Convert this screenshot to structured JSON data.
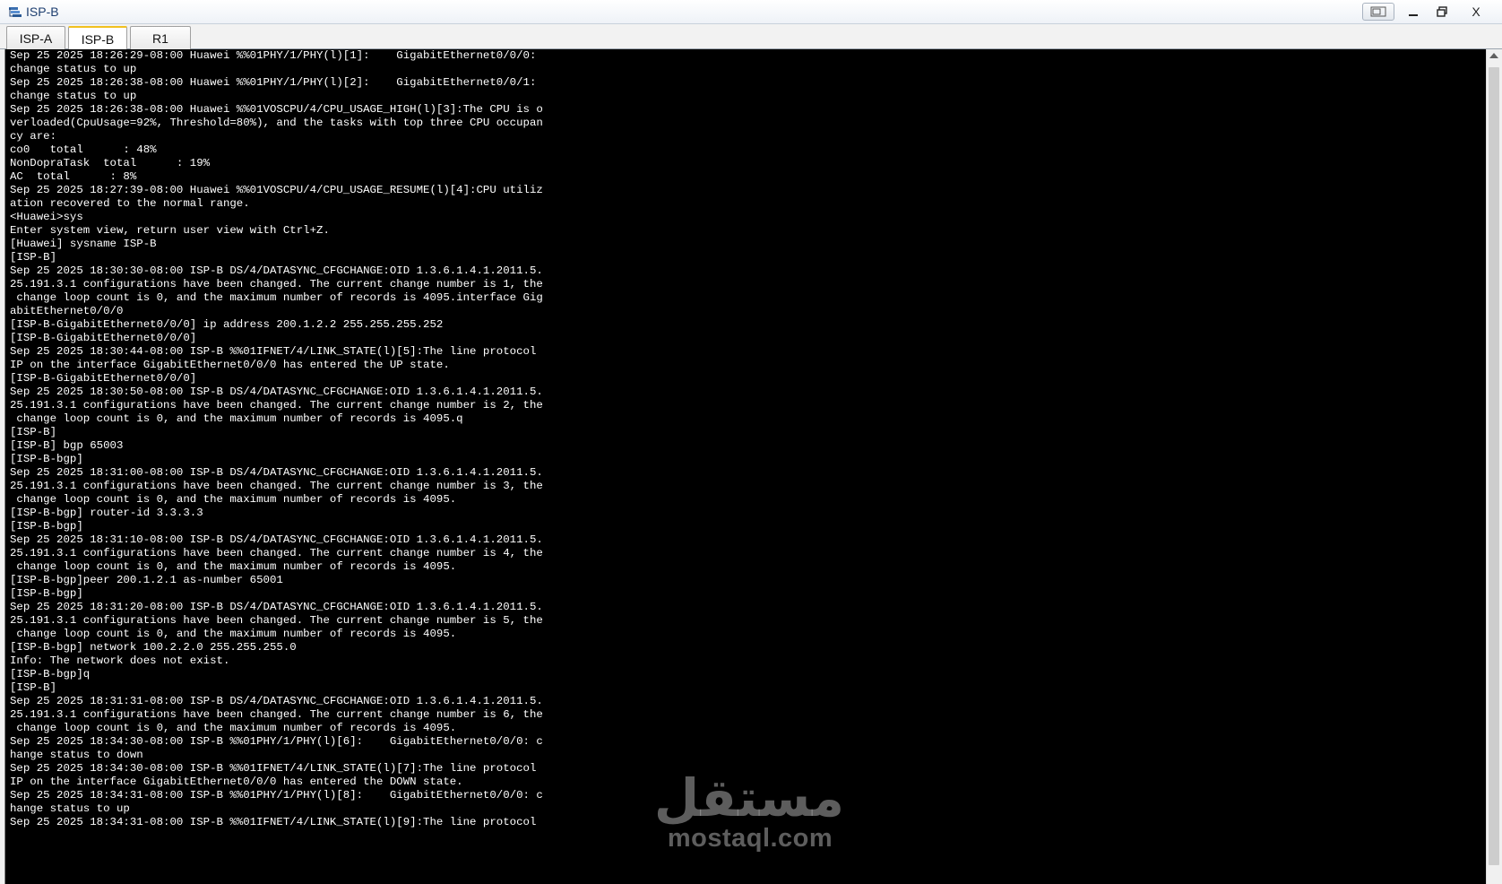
{
  "window": {
    "title": "ISP-B",
    "controls": {
      "extra": "▭",
      "minimize": "–",
      "maximize": "🗗",
      "close": "X"
    }
  },
  "tabs": [
    {
      "label": "ISP-A",
      "active": false
    },
    {
      "label": "ISP-B",
      "active": true
    },
    {
      "label": "R1",
      "active": false
    }
  ],
  "terminal": {
    "lines": [
      "Sep 25 2025 18:26:29-08:00 Huawei %%01PHY/1/PHY(l)[1]:    GigabitEthernet0/0/0:",
      "change status to up",
      "Sep 25 2025 18:26:38-08:00 Huawei %%01PHY/1/PHY(l)[2]:    GigabitEthernet0/0/1:",
      "change status to up",
      "Sep 25 2025 18:26:38-08:00 Huawei %%01VOSCPU/4/CPU_USAGE_HIGH(l)[3]:The CPU is o",
      "verloaded(CpuUsage=92%, Threshold=80%), and the tasks with top three CPU occupan",
      "cy are:",
      "co0   total      : 48%",
      "NonDopraTask  total      : 19%",
      "AC  total      : 8%",
      "Sep 25 2025 18:27:39-08:00 Huawei %%01VOSCPU/4/CPU_USAGE_RESUME(l)[4]:CPU utiliz",
      "ation recovered to the normal range.",
      "<Huawei>sys",
      "Enter system view, return user view with Ctrl+Z.",
      "[Huawei] sysname ISP-B",
      "[ISP-B]",
      "Sep 25 2025 18:30:30-08:00 ISP-B DS/4/DATASYNC_CFGCHANGE:OID 1.3.6.1.4.1.2011.5.",
      "25.191.3.1 configurations have been changed. The current change number is 1, the",
      " change loop count is 0, and the maximum number of records is 4095.interface Gig",
      "abitEthernet0/0/0",
      "[ISP-B-GigabitEthernet0/0/0] ip address 200.1.2.2 255.255.255.252",
      "[ISP-B-GigabitEthernet0/0/0]",
      "Sep 25 2025 18:30:44-08:00 ISP-B %%01IFNET/4/LINK_STATE(l)[5]:The line protocol",
      "IP on the interface GigabitEthernet0/0/0 has entered the UP state.",
      "[ISP-B-GigabitEthernet0/0/0]",
      "Sep 25 2025 18:30:50-08:00 ISP-B DS/4/DATASYNC_CFGCHANGE:OID 1.3.6.1.4.1.2011.5.",
      "25.191.3.1 configurations have been changed. The current change number is 2, the",
      " change loop count is 0, and the maximum number of records is 4095.q",
      "[ISP-B]",
      "[ISP-B] bgp 65003",
      "[ISP-B-bgp]",
      "Sep 25 2025 18:31:00-08:00 ISP-B DS/4/DATASYNC_CFGCHANGE:OID 1.3.6.1.4.1.2011.5.",
      "25.191.3.1 configurations have been changed. The current change number is 3, the",
      " change loop count is 0, and the maximum number of records is 4095.",
      "[ISP-B-bgp] router-id 3.3.3.3",
      "[ISP-B-bgp]",
      "Sep 25 2025 18:31:10-08:00 ISP-B DS/4/DATASYNC_CFGCHANGE:OID 1.3.6.1.4.1.2011.5.",
      "25.191.3.1 configurations have been changed. The current change number is 4, the",
      " change loop count is 0, and the maximum number of records is 4095.",
      "[ISP-B-bgp]peer 200.1.2.1 as-number 65001",
      "[ISP-B-bgp]",
      "Sep 25 2025 18:31:20-08:00 ISP-B DS/4/DATASYNC_CFGCHANGE:OID 1.3.6.1.4.1.2011.5.",
      "25.191.3.1 configurations have been changed. The current change number is 5, the",
      " change loop count is 0, and the maximum number of records is 4095.",
      "[ISP-B-bgp] network 100.2.2.0 255.255.255.0",
      "Info: The network does not exist.",
      "[ISP-B-bgp]q",
      "[ISP-B]",
      "Sep 25 2025 18:31:31-08:00 ISP-B DS/4/DATASYNC_CFGCHANGE:OID 1.3.6.1.4.1.2011.5.",
      "25.191.3.1 configurations have been changed. The current change number is 6, the",
      " change loop count is 0, and the maximum number of records is 4095.",
      "Sep 25 2025 18:34:30-08:00 ISP-B %%01PHY/1/PHY(l)[6]:    GigabitEthernet0/0/0: c",
      "hange status to down",
      "Sep 25 2025 18:34:30-08:00 ISP-B %%01IFNET/4/LINK_STATE(l)[7]:The line protocol",
      "IP on the interface GigabitEthernet0/0/0 has entered the DOWN state.",
      "Sep 25 2025 18:34:31-08:00 ISP-B %%01PHY/1/PHY(l)[8]:    GigabitEthernet0/0/0: c",
      "hange status to up",
      "Sep 25 2025 18:34:31-08:00 ISP-B %%01IFNET/4/LINK_STATE(l)[9]:The line protocol"
    ]
  },
  "watermark": {
    "arabic": "مستقل",
    "latin": "mostaql.com"
  }
}
